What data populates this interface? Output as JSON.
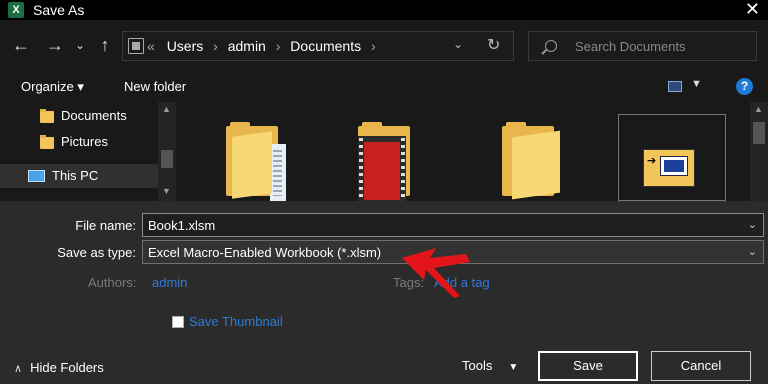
{
  "window": {
    "title": "Save As",
    "app_icon_letter": "X",
    "close_glyph": "✕"
  },
  "nav": {
    "back_glyph": "←",
    "forward_glyph": "→",
    "recent_glyph": "⌄",
    "up_glyph": "↑",
    "crumbs_prefix": "«",
    "breadcrumbs": [
      "Users",
      "admin",
      "Documents"
    ],
    "crumb_separator": "›",
    "dropdown_glyph": "⌄",
    "refresh_glyph": "↻",
    "search_placeholder": "Search Documents"
  },
  "toolbar": {
    "organize_label": "Organize ▾",
    "new_folder_label": "New folder",
    "view_dropdown_glyph": "▼",
    "help_glyph": "?"
  },
  "sidebar": {
    "items": [
      {
        "label": "Documents",
        "icon": "folder-icon"
      },
      {
        "label": "Pictures",
        "icon": "folder-icon"
      },
      {
        "label": "This PC",
        "icon": "computer-icon",
        "selected": true
      }
    ],
    "scroll_up_glyph": "▲",
    "scroll_down_glyph": "▼"
  },
  "files": {
    "tiles": [
      {
        "icon": "document-folder-icon"
      },
      {
        "icon": "video-folder-icon"
      },
      {
        "icon": "folder-icon"
      },
      {
        "icon": "library-folder-icon",
        "selected": true
      }
    ]
  },
  "form": {
    "file_name_label": "File name:",
    "file_name_value": "Book1.xlsm",
    "save_type_label": "Save as type:",
    "save_type_value": "Excel Macro-Enabled Workbook (*.xlsm)",
    "dropdown_glyph": "⌄",
    "authors_label": "Authors:",
    "authors_value": "admin",
    "tags_label": "Tags:",
    "tags_value": "Add a tag",
    "save_thumbnail_label": "Save Thumbnail",
    "save_thumbnail_checked": false,
    "hide_folders_chevron": "∧",
    "hide_folders_label": "Hide Folders",
    "tools_label": "Tools",
    "tools_dropdown_glyph": "▼",
    "save_label": "Save",
    "cancel_label": "Cancel"
  },
  "colors": {
    "accent_link": "#2e7bd6",
    "annotation_arrow": "#e3141a",
    "excel_green": "#1d6f42"
  }
}
